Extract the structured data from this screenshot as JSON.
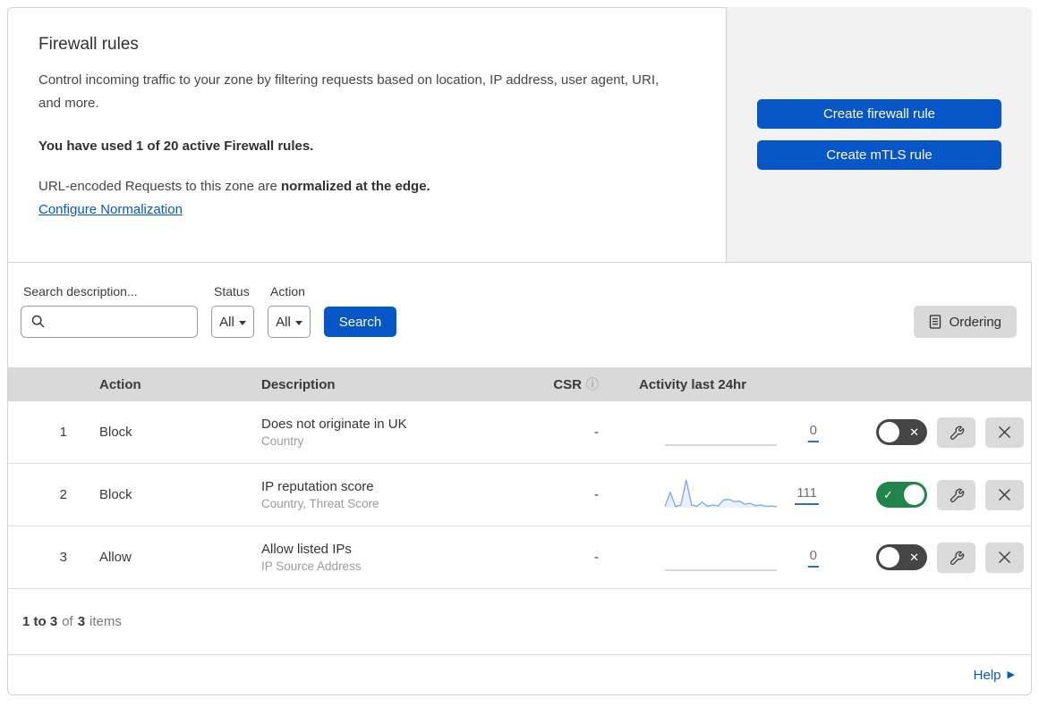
{
  "header": {
    "title": "Firewall rules",
    "description": "Control incoming traffic to your zone by filtering requests based on location, IP address, user agent, URI, and more.",
    "usage": "You have used 1 of 20 active Firewall rules.",
    "normalization_prefix": "URL-encoded Requests to this zone are",
    "normalization_bold": "normalized at the edge.",
    "normalization_link": "Configure Normalization"
  },
  "actions_panel": {
    "create_firewall_label": "Create firewall rule",
    "create_mtls_label": "Create mTLS rule"
  },
  "filters": {
    "search_label": "Search description...",
    "status_label": "Status",
    "status_value": "All",
    "action_label": "Action",
    "action_value": "All",
    "search_button": "Search",
    "ordering_button": "Ordering"
  },
  "table": {
    "columns": {
      "action": "Action",
      "description": "Description",
      "csr": "CSR",
      "activity": "Activity last 24hr"
    },
    "rows": [
      {
        "priority": "1",
        "action": "Block",
        "description": "Does not originate in UK",
        "fields": "Country",
        "csr": "-",
        "count": "0",
        "enabled": false,
        "sparkline": []
      },
      {
        "priority": "2",
        "action": "Block",
        "description": "IP reputation score",
        "fields": "Country, Threat Score",
        "csr": "-",
        "count": "111",
        "enabled": true,
        "sparkline": [
          4,
          55,
          4,
          10,
          100,
          10,
          5,
          20,
          5,
          10,
          6,
          28,
          30,
          22,
          24,
          12,
          16,
          7,
          10,
          5,
          6,
          4
        ]
      },
      {
        "priority": "3",
        "action": "Allow",
        "description": "Allow listed IPs",
        "fields": "IP Source Address",
        "csr": "-",
        "count": "0",
        "enabled": false,
        "sparkline": []
      }
    ]
  },
  "footer": {
    "range": "1 to 3",
    "of": "of",
    "total": "3",
    "items": "items"
  },
  "help": {
    "label": "Help"
  },
  "colors": {
    "accent_blue": "#0656c7",
    "toggle_on_green": "#21854b",
    "toggle_off_gray": "#454545",
    "sparkline_stroke": "#79a5ef",
    "sparkline_fill": "rgba(121,165,239,0.16)",
    "sparkline_zero_line": "#c8c8c8",
    "table_header_bg": "#d9d9d9"
  }
}
